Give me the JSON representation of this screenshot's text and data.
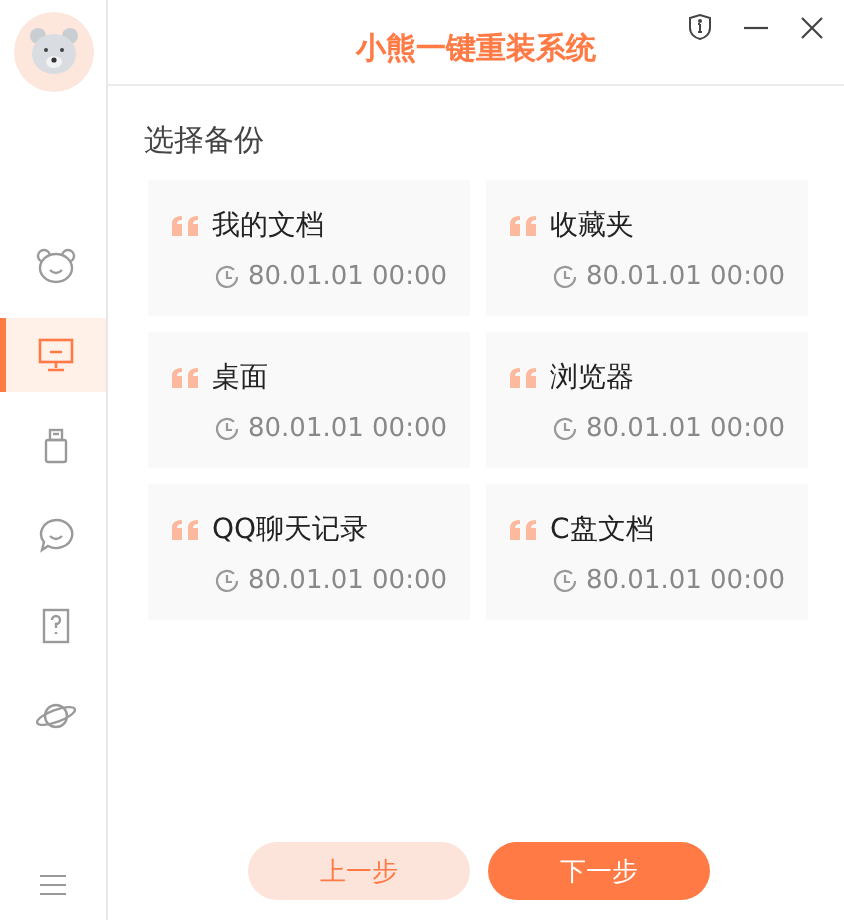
{
  "window": {
    "title": "小熊一键重装系统"
  },
  "sidebar": {
    "items": [
      {
        "kind": "bear",
        "selected": false
      },
      {
        "kind": "monitor",
        "selected": true
      },
      {
        "kind": "usb",
        "selected": false
      },
      {
        "kind": "chat",
        "selected": false
      },
      {
        "kind": "help",
        "selected": false
      },
      {
        "kind": "planet",
        "selected": false
      }
    ]
  },
  "section_title": "选择备份",
  "cards": [
    {
      "name": "我的文档",
      "time": "80.01.01 00:00"
    },
    {
      "name": "收藏夹",
      "time": "80.01.01 00:00"
    },
    {
      "name": "桌面",
      "time": "80.01.01 00:00"
    },
    {
      "name": "浏览器",
      "time": "80.01.01 00:00"
    },
    {
      "name": "QQ聊天记录",
      "time": "80.01.01 00:00"
    },
    {
      "name": "C盘文档",
      "time": "80.01.01 00:00"
    }
  ],
  "buttons": [
    {
      "label": "上一步",
      "kind": "secondary"
    },
    {
      "label": "下一步",
      "kind": "primary"
    }
  ]
}
